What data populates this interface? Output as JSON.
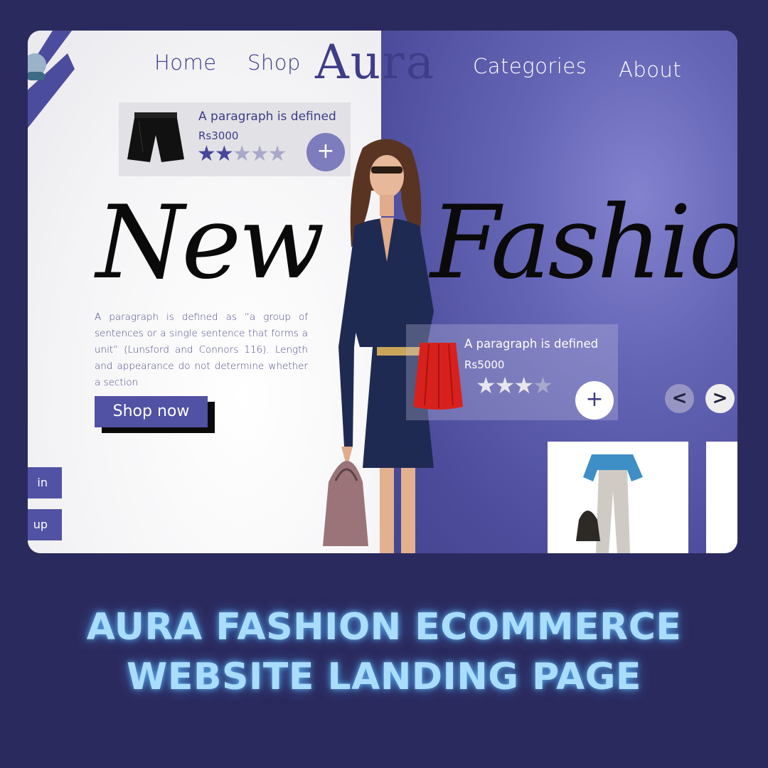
{
  "nav": {
    "home": "Home",
    "shop": "Shop",
    "brand": "Aura",
    "categories": "Categories",
    "about": "About"
  },
  "hero": {
    "headline_left": "New",
    "headline_right": "Fashion",
    "description": "A paragraph is defined as “a group of sentences or a single sentence that forms a unit” (Lunsford and Connors 116). Length and appearance do not determine whether a section",
    "shop_now": "Shop now"
  },
  "side_buttons": {
    "login": "in",
    "signup": "up"
  },
  "product_cards": [
    {
      "title": "A paragraph is defined",
      "price": "Rs3000",
      "rating": 2,
      "max_rating": 5,
      "add_label": "+"
    },
    {
      "title": "A paragraph is defined",
      "price": "Rs5000",
      "rating": 3,
      "max_rating": 4,
      "add_label": "+"
    }
  ],
  "carousel": {
    "prev": "<",
    "next": ">"
  },
  "caption": {
    "line1": "AURA FASHION ECOMMERCE",
    "line2": "WEBSITE LANDING PAGE"
  },
  "colors": {
    "background": "#2b2a5e",
    "accent": "#5152a3",
    "brand_text": "#3d3b86",
    "caption_glow": "#a9ddfb"
  },
  "icons": [
    "logo-mark-icon",
    "plus-icon",
    "star-icon",
    "chevron-left-icon",
    "chevron-right-icon"
  ]
}
